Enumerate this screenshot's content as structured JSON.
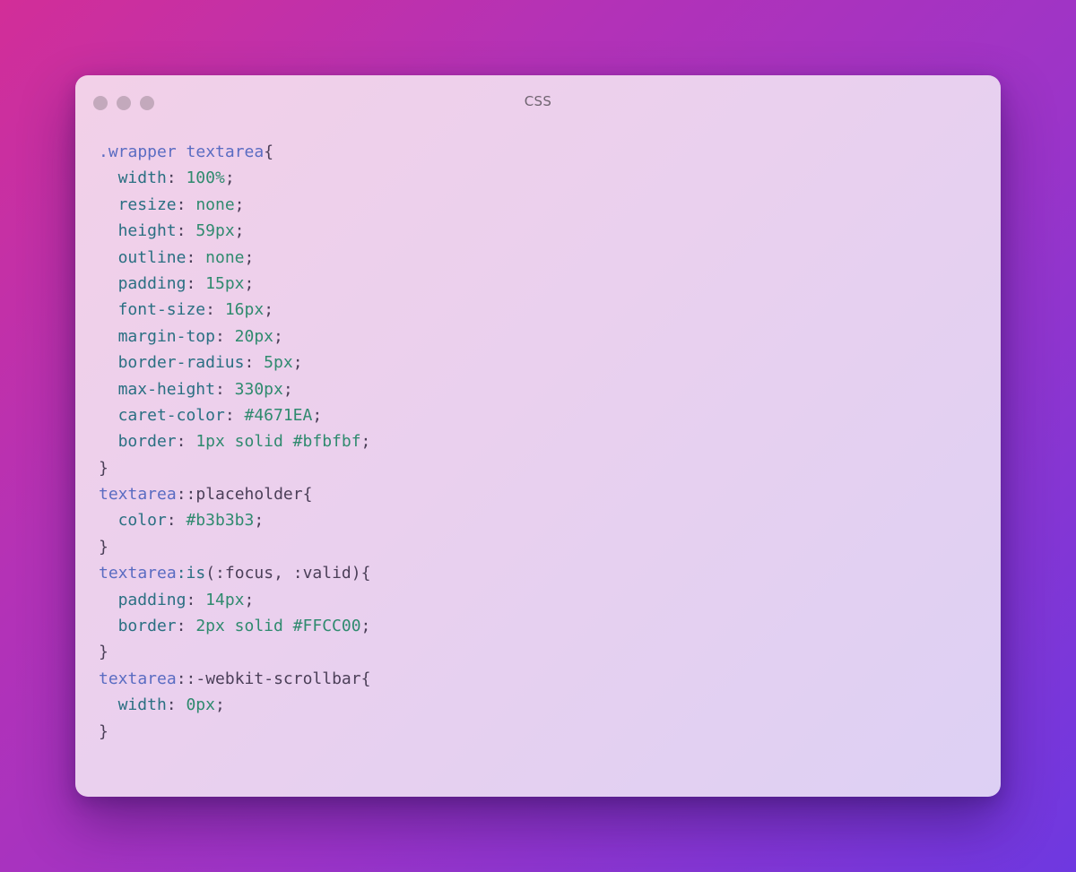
{
  "window": {
    "title": "CSS"
  },
  "code": {
    "language": "css",
    "lines": [
      {
        "indent": 0,
        "tokens": [
          {
            "t": ".wrapper textarea",
            "k": "sel"
          },
          {
            "t": "{",
            "k": "brace"
          }
        ]
      },
      {
        "indent": 1,
        "tokens": [
          {
            "t": "width",
            "k": "prop"
          },
          {
            "t": ": ",
            "k": "punct"
          },
          {
            "t": "100%",
            "k": "val"
          },
          {
            "t": ";",
            "k": "punct"
          }
        ]
      },
      {
        "indent": 1,
        "tokens": [
          {
            "t": "resize",
            "k": "prop"
          },
          {
            "t": ": ",
            "k": "punct"
          },
          {
            "t": "none",
            "k": "val"
          },
          {
            "t": ";",
            "k": "punct"
          }
        ]
      },
      {
        "indent": 1,
        "tokens": [
          {
            "t": "height",
            "k": "prop"
          },
          {
            "t": ": ",
            "k": "punct"
          },
          {
            "t": "59px",
            "k": "val"
          },
          {
            "t": ";",
            "k": "punct"
          }
        ]
      },
      {
        "indent": 1,
        "tokens": [
          {
            "t": "outline",
            "k": "prop"
          },
          {
            "t": ": ",
            "k": "punct"
          },
          {
            "t": "none",
            "k": "val"
          },
          {
            "t": ";",
            "k": "punct"
          }
        ]
      },
      {
        "indent": 1,
        "tokens": [
          {
            "t": "padding",
            "k": "prop"
          },
          {
            "t": ": ",
            "k": "punct"
          },
          {
            "t": "15px",
            "k": "val"
          },
          {
            "t": ";",
            "k": "punct"
          }
        ]
      },
      {
        "indent": 1,
        "tokens": [
          {
            "t": "font-size",
            "k": "prop"
          },
          {
            "t": ": ",
            "k": "punct"
          },
          {
            "t": "16px",
            "k": "val"
          },
          {
            "t": ";",
            "k": "punct"
          }
        ]
      },
      {
        "indent": 1,
        "tokens": [
          {
            "t": "margin-top",
            "k": "prop"
          },
          {
            "t": ": ",
            "k": "punct"
          },
          {
            "t": "20px",
            "k": "val"
          },
          {
            "t": ";",
            "k": "punct"
          }
        ]
      },
      {
        "indent": 1,
        "tokens": [
          {
            "t": "border-radius",
            "k": "prop"
          },
          {
            "t": ": ",
            "k": "punct"
          },
          {
            "t": "5px",
            "k": "val"
          },
          {
            "t": ";",
            "k": "punct"
          }
        ]
      },
      {
        "indent": 1,
        "tokens": [
          {
            "t": "max-height",
            "k": "prop"
          },
          {
            "t": ": ",
            "k": "punct"
          },
          {
            "t": "330px",
            "k": "val"
          },
          {
            "t": ";",
            "k": "punct"
          }
        ]
      },
      {
        "indent": 1,
        "tokens": [
          {
            "t": "caret-color",
            "k": "prop"
          },
          {
            "t": ": ",
            "k": "punct"
          },
          {
            "t": "#4671EA",
            "k": "val"
          },
          {
            "t": ";",
            "k": "punct"
          }
        ]
      },
      {
        "indent": 1,
        "tokens": [
          {
            "t": "border",
            "k": "prop"
          },
          {
            "t": ": ",
            "k": "punct"
          },
          {
            "t": "1px solid #bfbfbf",
            "k": "val"
          },
          {
            "t": ";",
            "k": "punct"
          }
        ]
      },
      {
        "indent": 0,
        "tokens": [
          {
            "t": "}",
            "k": "brace"
          }
        ]
      },
      {
        "indent": 0,
        "tokens": [
          {
            "t": "textarea",
            "k": "sel"
          },
          {
            "t": "::placeholder",
            "k": "pseudo"
          },
          {
            "t": "{",
            "k": "brace"
          }
        ]
      },
      {
        "indent": 1,
        "tokens": [
          {
            "t": "color",
            "k": "prop"
          },
          {
            "t": ": ",
            "k": "punct"
          },
          {
            "t": "#b3b3b3",
            "k": "val"
          },
          {
            "t": ";",
            "k": "punct"
          }
        ]
      },
      {
        "indent": 0,
        "tokens": [
          {
            "t": "}",
            "k": "brace"
          }
        ]
      },
      {
        "indent": 0,
        "tokens": [
          {
            "t": "textarea",
            "k": "sel"
          },
          {
            "t": ":is",
            "k": "prop"
          },
          {
            "t": "(:focus, :valid)",
            "k": "pseudo"
          },
          {
            "t": "{",
            "k": "brace"
          }
        ]
      },
      {
        "indent": 1,
        "tokens": [
          {
            "t": "padding",
            "k": "prop"
          },
          {
            "t": ": ",
            "k": "punct"
          },
          {
            "t": "14px",
            "k": "val"
          },
          {
            "t": ";",
            "k": "punct"
          }
        ]
      },
      {
        "indent": 1,
        "tokens": [
          {
            "t": "border",
            "k": "prop"
          },
          {
            "t": ": ",
            "k": "punct"
          },
          {
            "t": "2px solid #FFCC00",
            "k": "val"
          },
          {
            "t": ";",
            "k": "punct"
          }
        ]
      },
      {
        "indent": 0,
        "tokens": [
          {
            "t": "}",
            "k": "brace"
          }
        ]
      },
      {
        "indent": 0,
        "tokens": [
          {
            "t": "textarea",
            "k": "sel"
          },
          {
            "t": "::-webkit-scrollbar",
            "k": "pseudo"
          },
          {
            "t": "{",
            "k": "brace"
          }
        ]
      },
      {
        "indent": 1,
        "tokens": [
          {
            "t": "width",
            "k": "prop"
          },
          {
            "t": ": ",
            "k": "punct"
          },
          {
            "t": "0px",
            "k": "val"
          },
          {
            "t": ";",
            "k": "punct"
          }
        ]
      },
      {
        "indent": 0,
        "tokens": [
          {
            "t": "}",
            "k": "brace"
          }
        ]
      }
    ]
  },
  "colors": {
    "selector": "#5a6cc2",
    "property": "#2a6f82",
    "value": "#2f8a6e",
    "punctuation": "#4b3f58",
    "window_dot": "#c3a9bc"
  }
}
